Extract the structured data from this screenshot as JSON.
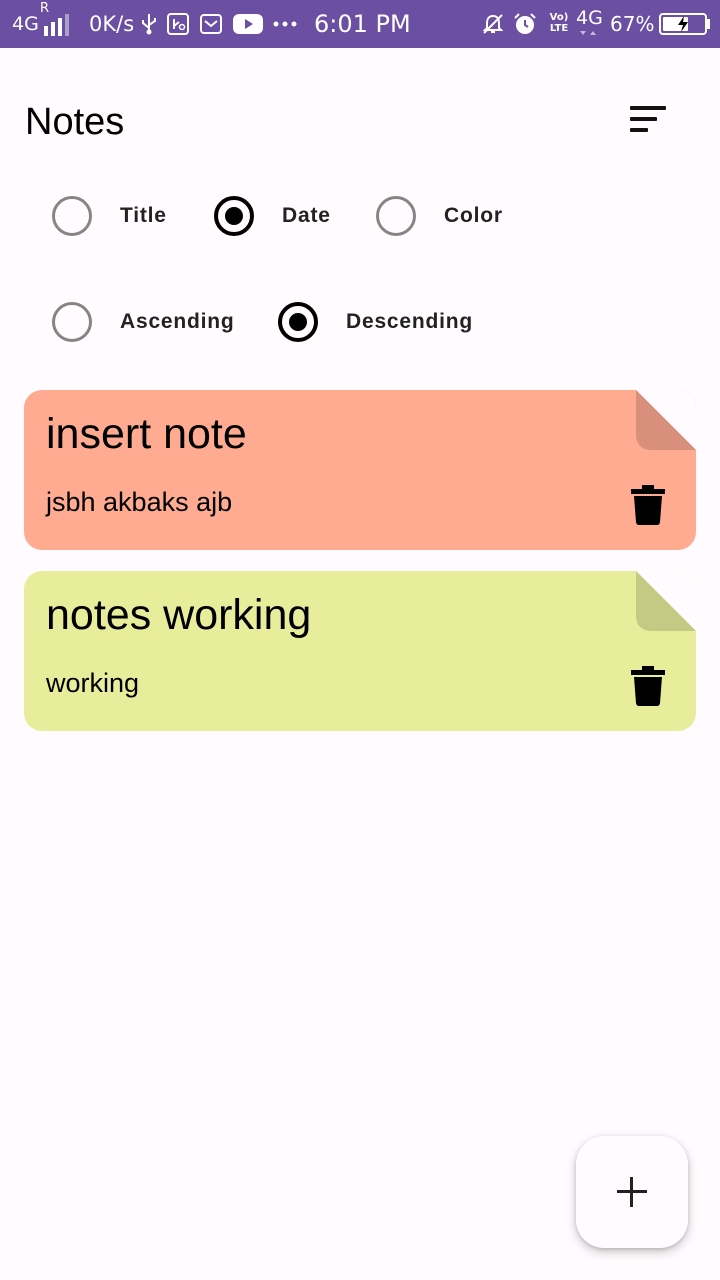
{
  "status_bar": {
    "network_type": "4G",
    "roaming": "R",
    "speed": "0K/s",
    "time": "6:01 PM",
    "volte": "Vo) LTE",
    "network_type_2": "4G",
    "battery_percent": "67%",
    "battery_level": 0.67,
    "icons": [
      "signal-icon",
      "usb-icon",
      "usb-debug-icon",
      "gallery-icon",
      "youtube-icon",
      "more-dots-icon",
      "silent-icon",
      "alarm-icon",
      "volte-icon",
      "battery-icon"
    ]
  },
  "header": {
    "title": "Notes",
    "sort_icon": "sort-icon"
  },
  "sort_by": {
    "options": [
      {
        "label": "Title",
        "checked": false
      },
      {
        "label": "Date",
        "checked": true
      },
      {
        "label": "Color",
        "checked": false
      }
    ]
  },
  "order": {
    "options": [
      {
        "label": "Ascending",
        "checked": false
      },
      {
        "label": "Descending",
        "checked": true
      }
    ]
  },
  "notes": [
    {
      "title": "insert note",
      "content": "jsbh akbaks ajb",
      "color": "#ffab91",
      "fold_color": "#d88f7b"
    },
    {
      "title": "notes working",
      "content": "working",
      "color": "#e7ed9b",
      "fold_color": "#c4c984"
    }
  ],
  "fab": {
    "icon": "plus-icon"
  },
  "colors": {
    "status_bar": "#6a4fa3",
    "background": "#fffbfe"
  }
}
